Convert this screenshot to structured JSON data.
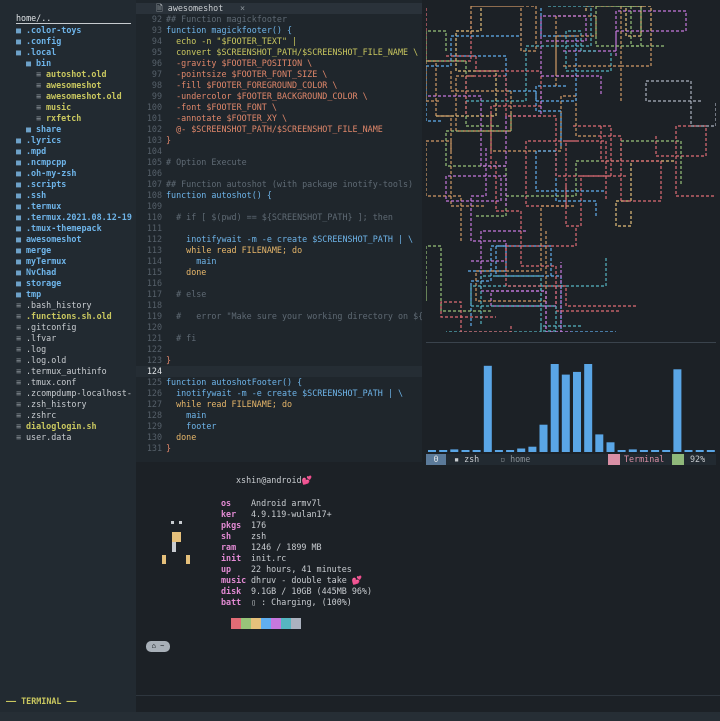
{
  "sidebar": {
    "header": "home/..",
    "items": [
      {
        "name": ".color-toys",
        "kind": "dir",
        "depth": 0
      },
      {
        "name": ".config",
        "kind": "dir",
        "depth": 0
      },
      {
        "name": ".local",
        "kind": "dir",
        "depth": 0
      },
      {
        "name": "bin",
        "kind": "dir",
        "depth": 1
      },
      {
        "name": "autoshot.old",
        "kind": "exe",
        "depth": 2
      },
      {
        "name": "awesomeshot",
        "kind": "exe",
        "depth": 2
      },
      {
        "name": "awesomeshot.old",
        "kind": "exe",
        "depth": 2
      },
      {
        "name": "music",
        "kind": "exe",
        "depth": 2
      },
      {
        "name": "rxfetch",
        "kind": "exe",
        "depth": 2
      },
      {
        "name": "share",
        "kind": "dir",
        "depth": 1
      },
      {
        "name": ".lyrics",
        "kind": "dir",
        "depth": 0
      },
      {
        "name": ".mpd",
        "kind": "dir",
        "depth": 0
      },
      {
        "name": ".ncmpcpp",
        "kind": "dir",
        "depth": 0
      },
      {
        "name": ".oh-my-zsh",
        "kind": "dir",
        "depth": 0
      },
      {
        "name": ".scripts",
        "kind": "dir",
        "depth": 0
      },
      {
        "name": ".ssh",
        "kind": "dir",
        "depth": 0
      },
      {
        "name": ".termux",
        "kind": "dir",
        "depth": 0
      },
      {
        "name": ".termux.2021.08.12-19",
        "kind": "dir",
        "depth": 0
      },
      {
        "name": ".tmux-themepack",
        "kind": "dir",
        "depth": 0
      },
      {
        "name": "awesomeshot",
        "kind": "dir",
        "depth": 0
      },
      {
        "name": "merge",
        "kind": "dir",
        "depth": 0
      },
      {
        "name": "myTermux",
        "kind": "dir",
        "depth": 0
      },
      {
        "name": "NvChad",
        "kind": "dir",
        "depth": 0
      },
      {
        "name": "storage",
        "kind": "dir",
        "depth": 0
      },
      {
        "name": "tmp",
        "kind": "dir",
        "depth": 0
      },
      {
        "name": ".bash_history",
        "kind": "file",
        "depth": 0
      },
      {
        "name": ".functions.sh.old",
        "kind": "exe",
        "depth": 0
      },
      {
        "name": ".gitconfig",
        "kind": "file",
        "depth": 0
      },
      {
        "name": ".lfvar",
        "kind": "file",
        "depth": 0
      },
      {
        "name": ".log",
        "kind": "file",
        "depth": 0
      },
      {
        "name": ".log.old",
        "kind": "file",
        "depth": 0
      },
      {
        "name": ".termux_authinfo",
        "kind": "file",
        "depth": 0
      },
      {
        "name": ".tmux.conf",
        "kind": "file",
        "depth": 0
      },
      {
        "name": ".zcompdump-localhost-",
        "kind": "file",
        "depth": 0
      },
      {
        "name": ".zsh_history",
        "kind": "file",
        "depth": 0
      },
      {
        "name": ".zshrc",
        "kind": "file",
        "depth": 0
      },
      {
        "name": "dialoglogin.sh",
        "kind": "exe",
        "depth": 0
      },
      {
        "name": "user.data",
        "kind": "file",
        "depth": 0
      }
    ],
    "footer": "—— TERMINAL ——"
  },
  "editor": {
    "tab": "awesomeshot",
    "tab_close": "×",
    "current_line": "124",
    "lines": [
      {
        "n": "92",
        "t": "## Function magickfooter",
        "c": "c"
      },
      {
        "n": "93",
        "t": "function magickfooter() {",
        "c": "fn"
      },
      {
        "n": "94",
        "t": "  echo -n \"$FOOTER_TEXT\" |",
        "c": "s"
      },
      {
        "n": "95",
        "t": "  convert $SCREENSHOT_PATH/$SCREENSHOT_FILE_NAME \\",
        "c": "s"
      },
      {
        "n": "96",
        "t": "  -gravity $FOOTER_POSITION \\",
        "c": "p"
      },
      {
        "n": "97",
        "t": "  -pointsize $FOOTER_FONT_SIZE \\",
        "c": "p"
      },
      {
        "n": "98",
        "t": "  -fill $FOOTER_FOREGROUND_COLOR \\",
        "c": "p"
      },
      {
        "n": "99",
        "t": "  -undercolor $FOOTER_BACKGROUND_COLOR \\",
        "c": "p"
      },
      {
        "n": "100",
        "t": "  -font $FOOTER_FONT \\",
        "c": "p"
      },
      {
        "n": "101",
        "t": "  -annotate $FOOTER_XY \\",
        "c": "p"
      },
      {
        "n": "102",
        "t": "  @- $SCREENSHOT_PATH/$SCREENSHOT_FILE_NAME",
        "c": "p"
      },
      {
        "n": "103",
        "t": "}",
        "c": "p"
      },
      {
        "n": "104",
        "t": "",
        "c": "w"
      },
      {
        "n": "105",
        "t": "# Option Execute",
        "c": "c"
      },
      {
        "n": "106",
        "t": "",
        "c": "w"
      },
      {
        "n": "107",
        "t": "## Function autoshot (with package inotify-tools)",
        "c": "c"
      },
      {
        "n": "108",
        "t": "function autoshot() {",
        "c": "fn"
      },
      {
        "n": "109",
        "t": "",
        "c": "w"
      },
      {
        "n": "110",
        "t": "  # if [ $(pwd) == ${SCREENSHOT_PATH} ]; then",
        "c": "c"
      },
      {
        "n": "111",
        "t": "",
        "c": "w"
      },
      {
        "n": "112",
        "t": "    inotifywait -m -e create $SCREENSHOT_PATH | \\",
        "c": "fn"
      },
      {
        "n": "113",
        "t": "    while read FILENAME; do",
        "c": "b"
      },
      {
        "n": "114",
        "t": "      main",
        "c": "fn"
      },
      {
        "n": "115",
        "t": "    done",
        "c": "b"
      },
      {
        "n": "116",
        "t": "",
        "c": "w"
      },
      {
        "n": "117",
        "t": "  # else",
        "c": "c"
      },
      {
        "n": "118",
        "t": "",
        "c": "w"
      },
      {
        "n": "119",
        "t": "  #   error \"Make sure your working directory on ${",
        "c": "c"
      },
      {
        "n": "120",
        "t": "",
        "c": "w"
      },
      {
        "n": "121",
        "t": "  # fi",
        "c": "c"
      },
      {
        "n": "122",
        "t": "",
        "c": "w"
      },
      {
        "n": "123",
        "t": "}",
        "c": "p"
      },
      {
        "n": "124",
        "t": "",
        "c": "w"
      },
      {
        "n": "125",
        "t": "function autoshotFooter() {",
        "c": "fn"
      },
      {
        "n": "126",
        "t": "  inotifywait -m -e create $SCREENSHOT_PATH | \\",
        "c": "fn"
      },
      {
        "n": "127",
        "t": "  while read FILENAME; do",
        "c": "b"
      },
      {
        "n": "128",
        "t": "    main",
        "c": "fn"
      },
      {
        "n": "129",
        "t": "    footer",
        "c": "fn"
      },
      {
        "n": "130",
        "t": "  done",
        "c": "b"
      },
      {
        "n": "131",
        "t": "}",
        "c": "p"
      }
    ]
  },
  "visualizer": {
    "bar_levels": [
      0.02,
      0.02,
      0.03,
      0.02,
      0.02,
      0.98,
      0.02,
      0.02,
      0.04,
      0.06,
      0.31,
      1.0,
      0.88,
      0.91,
      1.0,
      0.2,
      0.11,
      0.02,
      0.03,
      0.02,
      0.02,
      0.02,
      0.94,
      0.02,
      0.02,
      0.02
    ],
    "bar_color": "#5aa6e6"
  },
  "tmux": {
    "left_badge": "0",
    "win1": "zsh",
    "win2": "home",
    "right_label": "Terminal",
    "battery": "92%"
  },
  "fetch": {
    "title_user": "xshin",
    "title_at": "@",
    "title_host": "android",
    "title_heart": "💕",
    "rows": [
      {
        "k": "os",
        "v": "Android armv7l"
      },
      {
        "k": "ker",
        "v": "4.9.119-wulan17+"
      },
      {
        "k": "pkgs",
        "v": "176"
      },
      {
        "k": "sh",
        "v": "zsh"
      },
      {
        "k": "ram",
        "v": "1246 / 1899 MB"
      },
      {
        "k": "init",
        "v": "init.rc"
      },
      {
        "k": "up",
        "v": "22 hours, 41 minutes"
      },
      {
        "k": "music",
        "v": "dhruv - double take 💕"
      },
      {
        "k": "disk",
        "v": "9.1GB / 10GB (445MB 96%)"
      },
      {
        "k": "batt",
        "v": "▯ : Charging, (100%)"
      }
    ],
    "palette": [
      "#e06c75",
      "#98c379",
      "#e5c07b",
      "#61afef",
      "#c678dd",
      "#56b6c2",
      "#abb2bf"
    ],
    "prompt": "~"
  },
  "colors": {
    "dir": "#6eb4e9",
    "exe": "#c9c75f",
    "keyword": "#e28ad3",
    "accent": "#5aa6e6"
  }
}
